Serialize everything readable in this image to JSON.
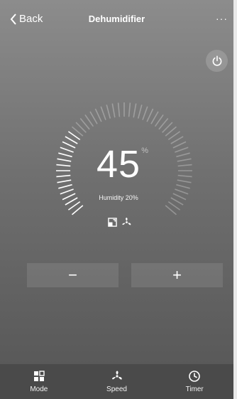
{
  "header": {
    "back_label": "Back",
    "title": "Dehumidifier",
    "more_label": "···"
  },
  "display": {
    "value": "45",
    "unit": "%",
    "humidity_label": "Humidity 20%"
  },
  "controls": {
    "minus_label": "−",
    "plus_label": "+"
  },
  "bottom_nav": {
    "mode_label": "Mode",
    "speed_label": "Speed",
    "timer_label": "Timer"
  },
  "icons": [
    "chevron-left-icon",
    "power-icon",
    "mode-icon",
    "fan-icon",
    "timer-icon"
  ],
  "colors": {
    "accent": "#ffffff",
    "dim_tick": "#9a9a9a",
    "bottom_bar": "#4a4a4a"
  }
}
